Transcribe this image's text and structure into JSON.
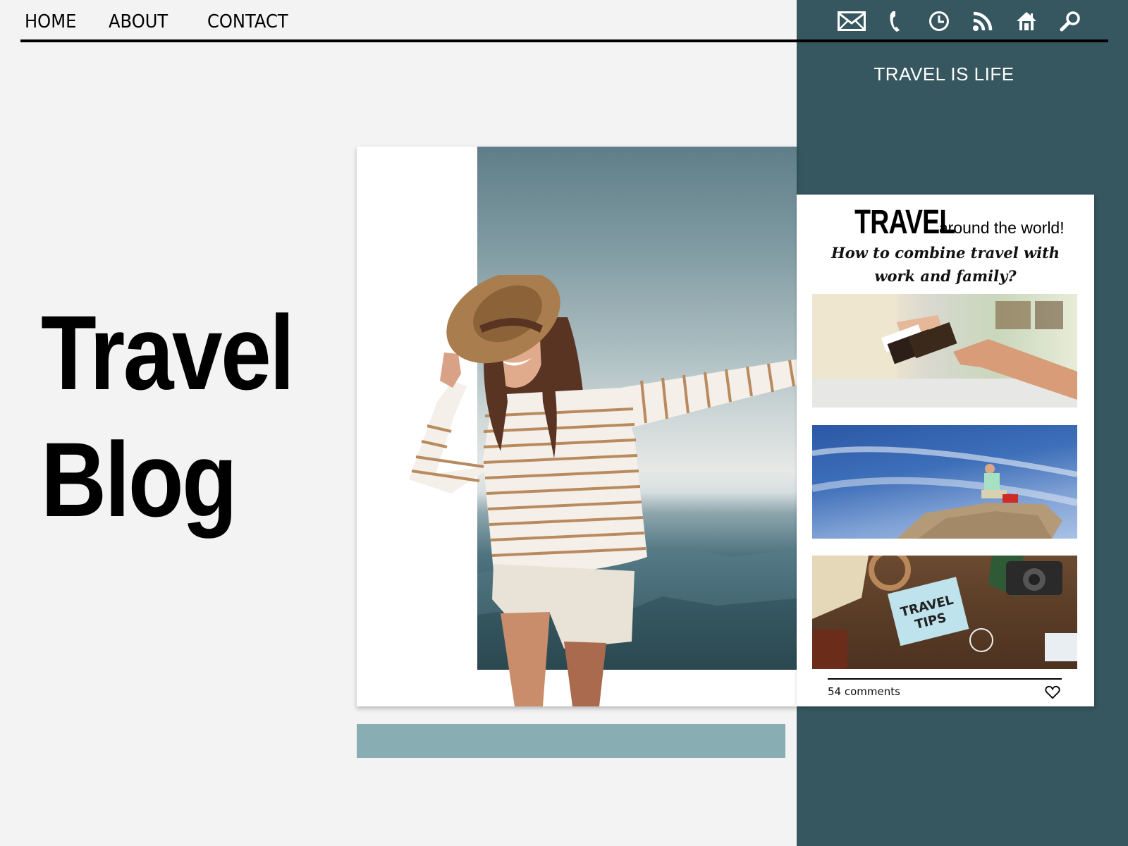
{
  "nav": {
    "items": [
      {
        "label": "HOME"
      },
      {
        "label": "ABOUT"
      },
      {
        "label": "CONTACT"
      }
    ]
  },
  "toolbar": {
    "icons": [
      "mail-icon",
      "phone-icon",
      "clock-icon",
      "rss-icon",
      "home-icon",
      "search-icon"
    ]
  },
  "sidebar": {
    "tagline": "TRAVEL IS LIFE"
  },
  "hero": {
    "title_line1": "Travel",
    "title_line2": "Blog"
  },
  "article": {
    "headline_big": "TRAVEL",
    "headline_small": "around the world!",
    "subtitle_line1": "How to combine travel with",
    "subtitle_line2": "work and family?",
    "thumbnails": [
      {
        "description": "Passports and boarding passes handed over at check-in"
      },
      {
        "description": "Hiker sitting on a rock under blue sky"
      },
      {
        "description": "Notebook reading TRAVEL TIPS on wooden table",
        "text_line1": "TRAVEL",
        "text_line2": "TIPS"
      }
    ],
    "comments_label": "54 comments"
  },
  "colors": {
    "background": "#f3f3f3",
    "sidebar": "#36575f",
    "accent_bar": "#88aeb4",
    "card": "#ffffff",
    "text": "#000000"
  }
}
